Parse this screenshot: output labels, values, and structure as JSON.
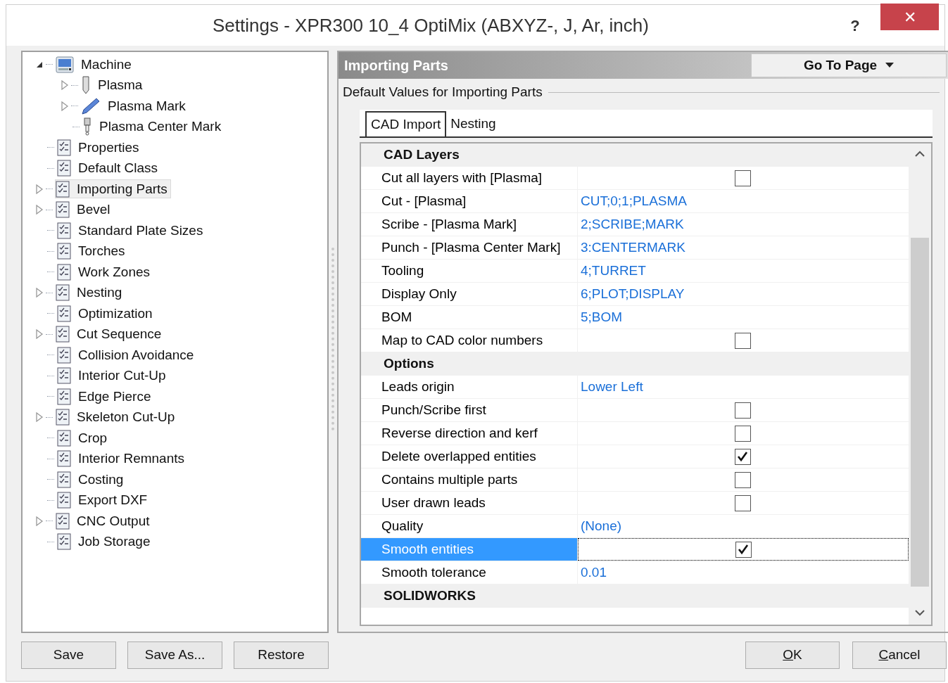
{
  "window": {
    "title": "Settings - XPR300 10_4 OptiMix (ABXYZ-, J, Ar, inch)",
    "help": "?",
    "close": "✕"
  },
  "tree": [
    {
      "label": "Machine",
      "kind": "machine",
      "expanded": true,
      "selected": false,
      "children": [
        {
          "label": "Plasma",
          "kind": "torch",
          "expanded": false,
          "selected": false
        },
        {
          "label": "Plasma Mark",
          "kind": "pen",
          "expanded": false,
          "selected": false
        },
        {
          "label": "Plasma Center Mark",
          "kind": "punch",
          "selected": false
        }
      ]
    },
    {
      "label": "Properties",
      "kind": "page",
      "selected": false
    },
    {
      "label": "Default Class",
      "kind": "page",
      "selected": false
    },
    {
      "label": "Importing Parts",
      "kind": "page",
      "expanded": false,
      "selected": true
    },
    {
      "label": "Bevel",
      "kind": "page",
      "expanded": false,
      "selected": false
    },
    {
      "label": "Standard Plate Sizes",
      "kind": "page",
      "selected": false
    },
    {
      "label": "Torches",
      "kind": "page",
      "selected": false
    },
    {
      "label": "Work Zones",
      "kind": "page",
      "selected": false
    },
    {
      "label": "Nesting",
      "kind": "page",
      "expanded": false,
      "selected": false
    },
    {
      "label": "Optimization",
      "kind": "page",
      "selected": false
    },
    {
      "label": "Cut Sequence",
      "kind": "page",
      "expanded": false,
      "selected": false
    },
    {
      "label": "Collision Avoidance",
      "kind": "page",
      "selected": false
    },
    {
      "label": "Interior Cut-Up",
      "kind": "page",
      "selected": false
    },
    {
      "label": "Edge Pierce",
      "kind": "page",
      "selected": false
    },
    {
      "label": "Skeleton Cut-Up",
      "kind": "page",
      "expanded": false,
      "selected": false
    },
    {
      "label": "Crop",
      "kind": "page",
      "selected": false
    },
    {
      "label": "Interior Remnants",
      "kind": "page",
      "selected": false
    },
    {
      "label": "Costing",
      "kind": "page",
      "selected": false
    },
    {
      "label": "Export DXF",
      "kind": "page",
      "selected": false
    },
    {
      "label": "CNC Output",
      "kind": "page",
      "expanded": false,
      "selected": false
    },
    {
      "label": "Job Storage",
      "kind": "page",
      "selected": false
    }
  ],
  "page": {
    "title": "Importing Parts",
    "goto": "Go To Page",
    "group": "Default Values for Importing Parts",
    "tabs": [
      {
        "label": "CAD Import",
        "selected": true
      },
      {
        "label": "Nesting",
        "selected": false
      }
    ],
    "rows": [
      {
        "kind": "category",
        "label": "CAD Layers"
      },
      {
        "kind": "checkbox",
        "label": "Cut all layers with [Plasma]",
        "checked": false,
        "selected": false
      },
      {
        "kind": "value",
        "label": "Cut - [Plasma]",
        "value": "CUT;0;1;PLASMA",
        "selected": false
      },
      {
        "kind": "value",
        "label": "Scribe - [Plasma Mark]",
        "value": "2;SCRIBE;MARK",
        "selected": false
      },
      {
        "kind": "value",
        "label": "Punch - [Plasma Center Mark]",
        "value": "3:CENTERMARK",
        "selected": false
      },
      {
        "kind": "value",
        "label": "Tooling",
        "value": "4;TURRET",
        "selected": false
      },
      {
        "kind": "value",
        "label": "Display Only",
        "value": "6;PLOT;DISPLAY",
        "selected": false
      },
      {
        "kind": "value",
        "label": "BOM",
        "value": "5;BOM",
        "selected": false
      },
      {
        "kind": "checkbox",
        "label": "Map to CAD color numbers",
        "checked": false,
        "selected": false
      },
      {
        "kind": "category",
        "label": "Options"
      },
      {
        "kind": "value",
        "label": "Leads origin",
        "value": "Lower Left",
        "selected": false
      },
      {
        "kind": "checkbox",
        "label": "Punch/Scribe first",
        "checked": false,
        "selected": false
      },
      {
        "kind": "checkbox",
        "label": "Reverse direction and kerf",
        "checked": false,
        "selected": false
      },
      {
        "kind": "checkbox",
        "label": "Delete overlapped entities",
        "checked": true,
        "selected": false
      },
      {
        "kind": "checkbox",
        "label": "Contains multiple parts",
        "checked": false,
        "selected": false
      },
      {
        "kind": "checkbox",
        "label": "User drawn leads",
        "checked": false,
        "selected": false
      },
      {
        "kind": "value",
        "label": "Quality",
        "value": "(None)",
        "selected": false
      },
      {
        "kind": "checkbox",
        "label": "Smooth entities",
        "checked": true,
        "selected": true
      },
      {
        "kind": "value",
        "label": "Smooth tolerance",
        "value": "0.01",
        "selected": false
      },
      {
        "kind": "category",
        "label": "SOLIDWORKS"
      }
    ]
  },
  "left_buttons": [
    "Save",
    "Save As...",
    "Restore"
  ],
  "right_buttons": [
    "OK",
    "Cancel"
  ]
}
